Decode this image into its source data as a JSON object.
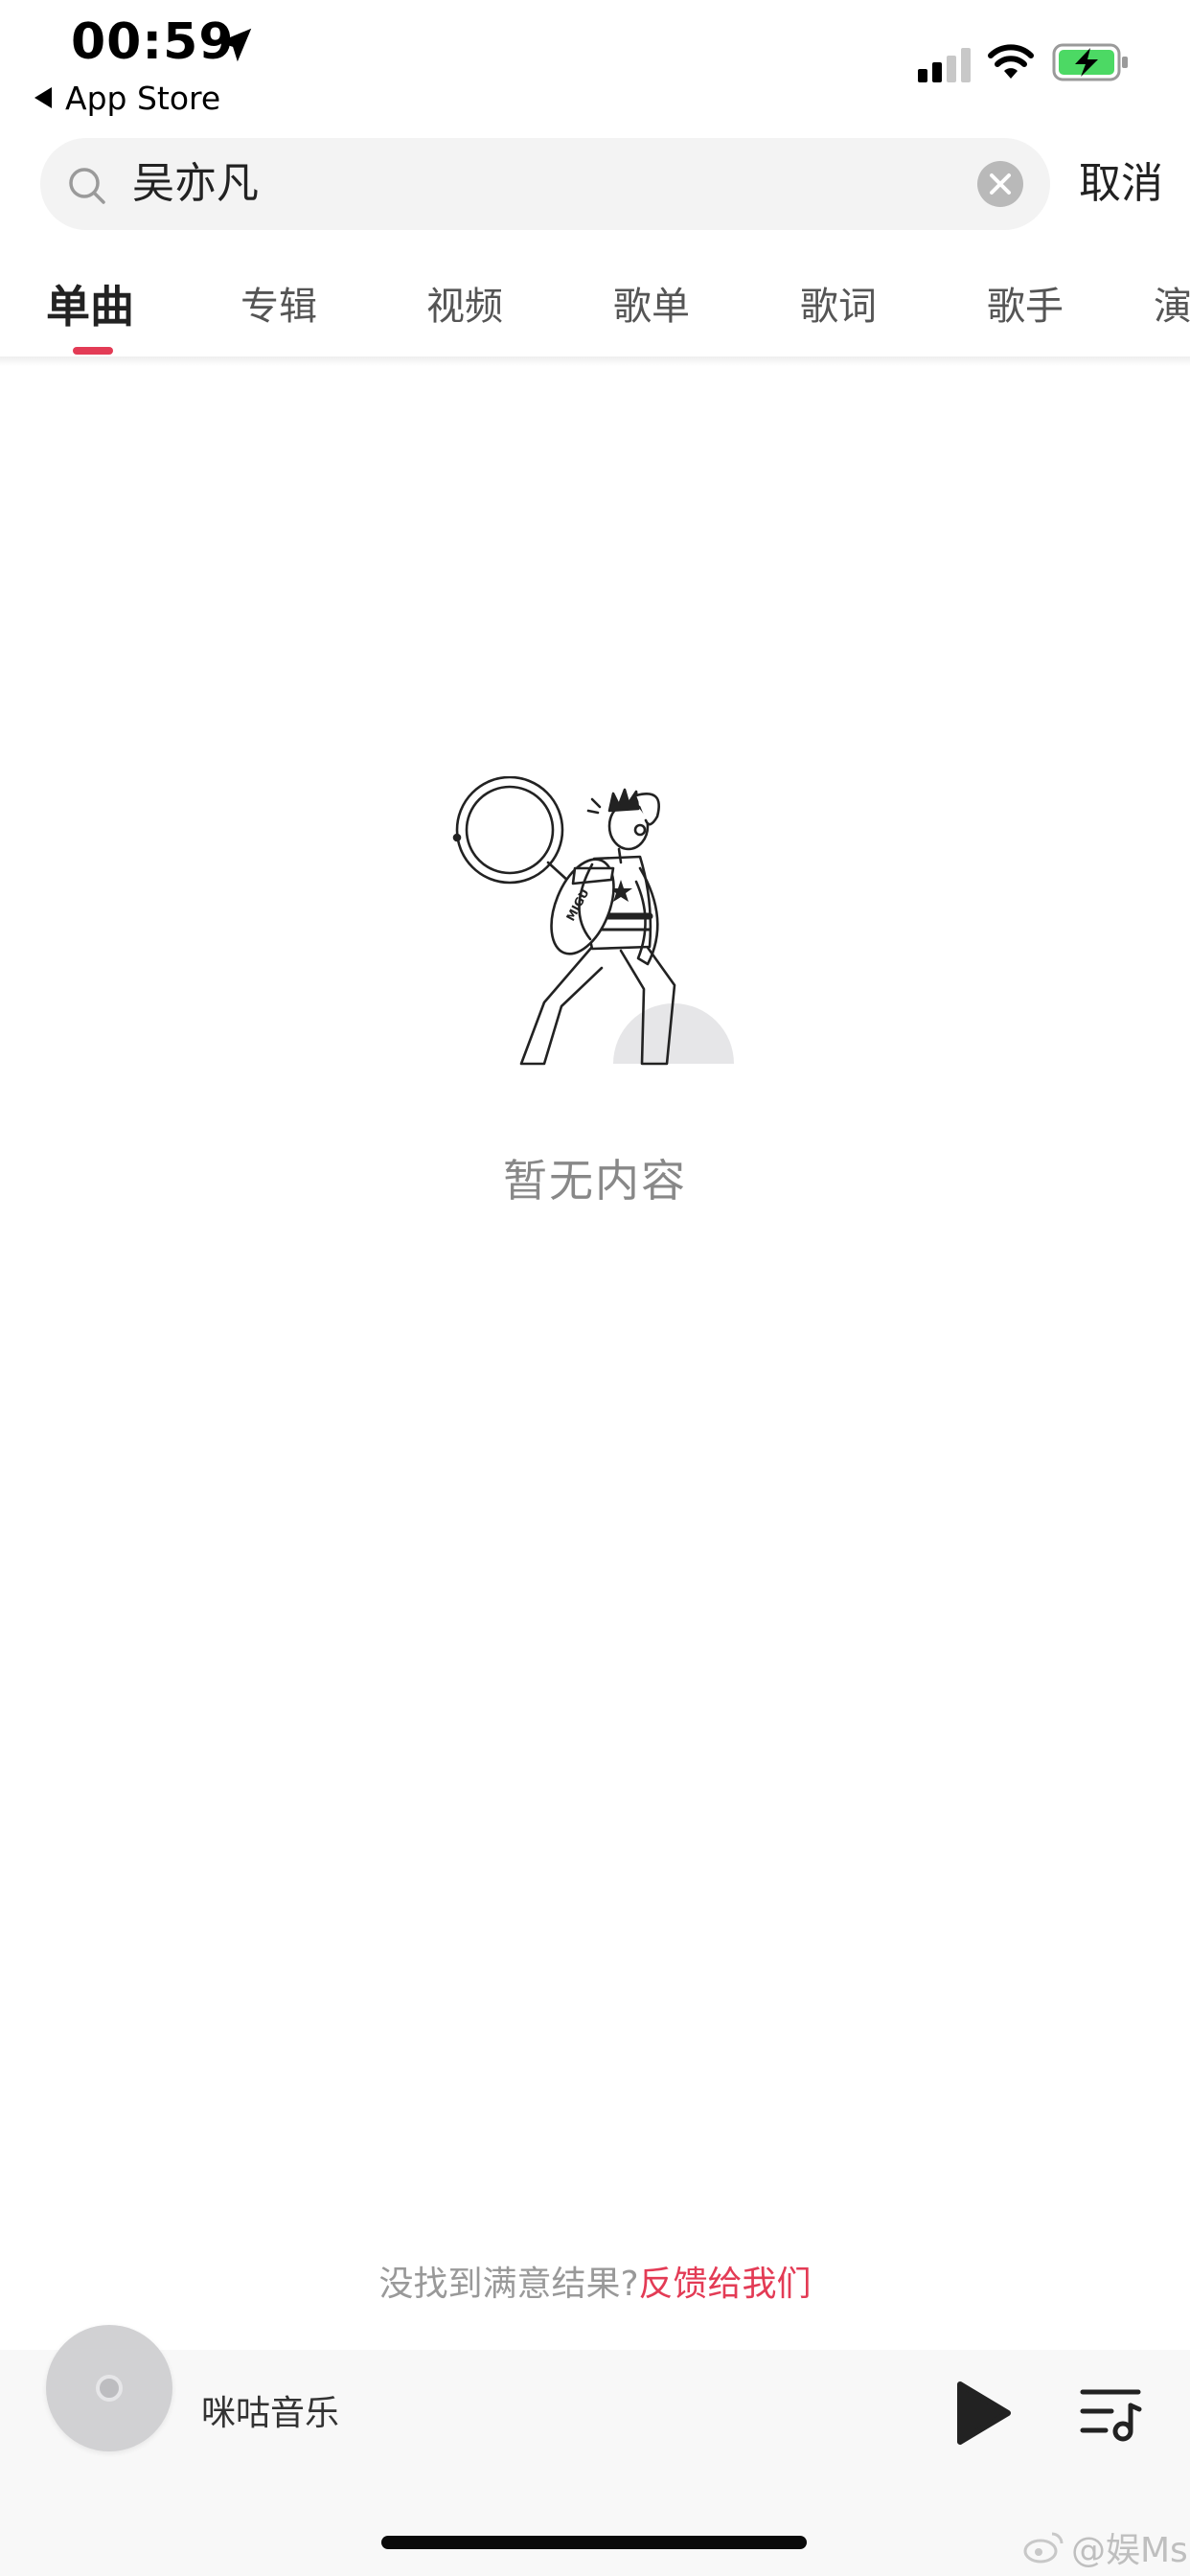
{
  "status_bar": {
    "time": "00:59",
    "back_label": "App Store",
    "icons": [
      "location-arrow-icon",
      "cellular-signal-icon",
      "wifi-icon",
      "battery-charging-icon"
    ]
  },
  "search": {
    "query": "吴亦凡",
    "cancel_label": "取消"
  },
  "tabs": [
    {
      "label": "单曲",
      "active": true
    },
    {
      "label": "专辑",
      "active": false
    },
    {
      "label": "视频",
      "active": false
    },
    {
      "label": "歌单",
      "active": false
    },
    {
      "label": "歌词",
      "active": false
    },
    {
      "label": "歌手",
      "active": false
    },
    {
      "label": "演",
      "active": false
    }
  ],
  "empty_state": {
    "message": "暂无内容",
    "badge_text": "MIGU"
  },
  "feedback": {
    "prompt": "没找到满意结果?",
    "link": "反馈给我们"
  },
  "player": {
    "title": "咪咕音乐"
  },
  "watermark": "@娱Ms",
  "colors": {
    "accent": "#e33b55",
    "battery_green": "#4cd964",
    "text_dark": "#222222",
    "text_muted": "#888888"
  }
}
